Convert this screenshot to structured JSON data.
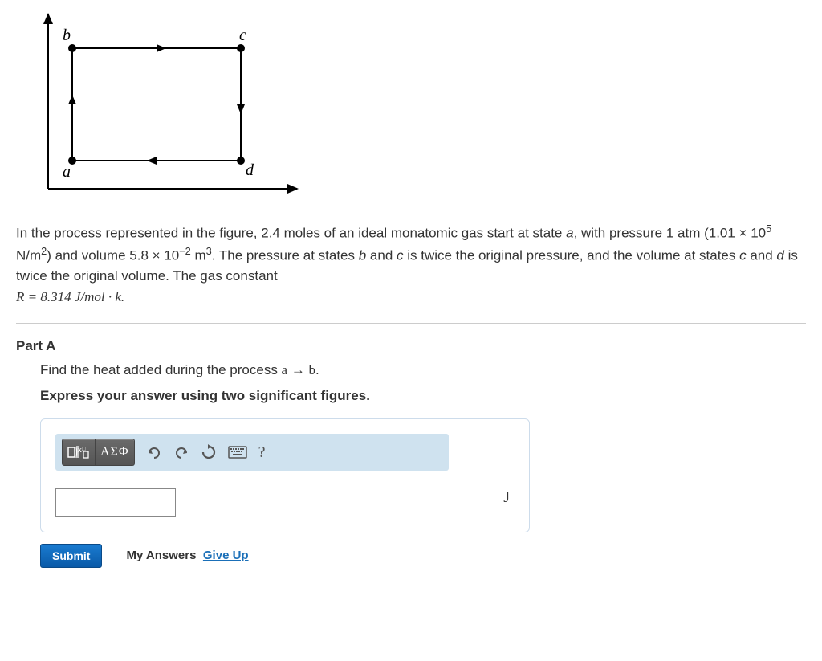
{
  "figure": {
    "labels": {
      "a": "a",
      "b": "b",
      "c": "c",
      "d": "d"
    }
  },
  "problem": {
    "text_pre": "In the process represented in the figure, 2.4 moles of an ideal monatomic gas start at state ",
    "state_a": "a",
    "text_pressure": ", with pressure 1 atm (1.01 × 10",
    "exp5": "5",
    "units_pressure": " N/m",
    "exp2": "2",
    "text_vol": ") and volume 5.8 × 10",
    "expm2": "−2",
    "units_vol": " m",
    "exp3": "3",
    "text_mid": ". The pressure at states ",
    "state_b": "b",
    "text_and1": " and ",
    "state_c": "c",
    "text_twice1": " is twice the original pressure, and the volume at states ",
    "state_c2": "c",
    "text_and2": " and ",
    "state_d": "d",
    "text_twice2": " is twice the original volume. The gas constant ",
    "R_eq": "R = 8.314 J/mol · k."
  },
  "partA": {
    "label": "Part A",
    "prompt_pre": "Find the heat added during the process ",
    "prompt_a": "a",
    "prompt_arrow": " → ",
    "prompt_b": "b",
    "prompt_period": ".",
    "instruction": "Express your answer using two significant figures.",
    "greek_btn": "ΑΣΦ",
    "unit": "J",
    "submit": "Submit",
    "my_answers": "My Answers",
    "give_up": "Give Up",
    "help": "?"
  }
}
